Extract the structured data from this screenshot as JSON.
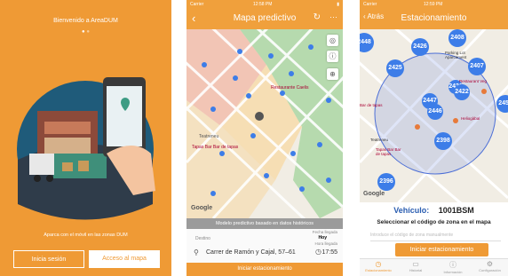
{
  "screen1": {
    "welcome": "Bienvenido a AreaDUM",
    "tagline": "Aparca con el móvil en las zonas DUM",
    "login_label": "Inicia sesión",
    "map_label": "Acceso al mapa"
  },
  "screen2": {
    "status": {
      "carrier": "Carrier",
      "time": "12:58 PM"
    },
    "title": "Mapa predictivo",
    "more_label": "···",
    "banner": "Modelo predictivo basado en datos históricos",
    "destino_label": "Destino",
    "fecha_llegada_label": "Fecha llegada",
    "fecha_llegada_value": "Hoy",
    "hora_llegada_label": "Hora llegada",
    "address": "Carrer de Ramón y Cajal, 57–61",
    "time": "17:55",
    "action": "Iniciar estacionamiento",
    "street_labels": [
      "Teatreneu",
      "Tapas Bar Bar de tapas",
      "Restaurante Caelis"
    ],
    "google": "Google"
  },
  "screen3": {
    "status": {
      "carrier": "Carrier",
      "time": "12:59 PM"
    },
    "back_label": "Atrás",
    "title": "Estacionamiento",
    "clusters": [
      "2448",
      "2426",
      "2408",
      "2407",
      "2422",
      "2425",
      "2421",
      "2447",
      "2446",
      "2422",
      "2398",
      "2396",
      "2456",
      "2421",
      "2420",
      "2410"
    ],
    "places": [
      "Parking Lot Aparcament",
      "Restaurant Veg",
      "Heliogàbal",
      "Teatreneu",
      "Tapas Bar Bar de tapas",
      "Bar de tapas"
    ],
    "vehicle_label": "Vehículo:",
    "vehicle_plate": "1001BSM",
    "select_zone": "Seleccionar el código de zona en el mapa",
    "zone_placeholder": "Introduce el código de zona manualmente",
    "action": "Iniciar estacionamiento",
    "tabs": [
      "Estacionamiento",
      "Historial",
      "Información",
      "Configuración"
    ],
    "google": "Google"
  },
  "colors": {
    "orange": "#ef9a35",
    "blue": "#3d7de8",
    "green_zone": "#a8d5a0",
    "red_zone": "#f2b7a6"
  }
}
